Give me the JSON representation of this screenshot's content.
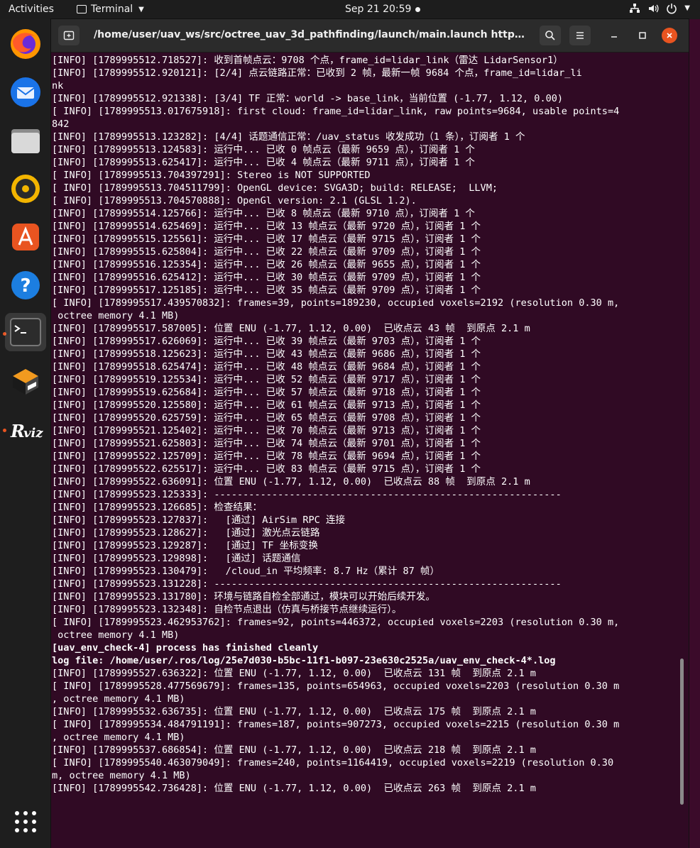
{
  "topbar": {
    "activities": "Activities",
    "app_name": "Terminal",
    "clock": "Sep 21  20:59"
  },
  "dock": {
    "items": [
      "firefox-icon",
      "thunderbird-icon",
      "files-icon",
      "rhythmbox-icon",
      "software-icon",
      "help-icon",
      "terminal-icon",
      "virtualbox-icon",
      "rviz-icon"
    ],
    "apps_grid": "show-applications-icon"
  },
  "window": {
    "title": "/home/user/uav_ws/src/octree_uav_3d_pathfinding/launch/main.launch http://loca..."
  },
  "terminal": {
    "lines": [
      "[INFO] [1789995512.718527]: 收到首帧点云：9708 个点，frame_id=lidar_link（雷达 LidarSensor1）",
      "[INFO] [1789995512.920121]: [2/4] 点云链路正常：已收到 2 帧，最新一帧 9684 个点，frame_id=lidar_li",
      "nk",
      "[INFO] [1789995512.921338]: [3/4] TF 正常：world -> base_link，当前位置 (-1.77, 1.12, 0.00)",
      "[ INFO] [1789995513.017675918]: first cloud: frame_id=lidar_link, raw points=9684, usable points=4",
      "842",
      "[INFO] [1789995513.123282]: [4/4] 话题通信正常：/uav_status 收发成功（1 条），订阅者 1 个",
      "[INFO] [1789995513.124583]: 运行中... 已收 0 帧点云（最新 9659 点），订阅者 1 个",
      "[INFO] [1789995513.625417]: 运行中... 已收 4 帧点云（最新 9711 点），订阅者 1 个",
      "[ INFO] [1789995513.704397291]: Stereo is NOT SUPPORTED",
      "[ INFO] [1789995513.704511799]: OpenGL device: SVGA3D; build: RELEASE;  LLVM;",
      "[ INFO] [1789995513.704570888]: OpenGl version: 2.1 (GLSL 1.2).",
      "[INFO] [1789995514.125766]: 运行中... 已收 8 帧点云（最新 9710 点），订阅者 1 个",
      "[INFO] [1789995514.625469]: 运行中... 已收 13 帧点云（最新 9720 点），订阅者 1 个",
      "[INFO] [1789995515.125561]: 运行中... 已收 17 帧点云（最新 9715 点），订阅者 1 个",
      "[INFO] [1789995515.625804]: 运行中... 已收 22 帧点云（最新 9709 点），订阅者 1 个",
      "[INFO] [1789995516.125354]: 运行中... 已收 26 帧点云（最新 9655 点），订阅者 1 个",
      "[INFO] [1789995516.625412]: 运行中... 已收 30 帧点云（最新 9709 点），订阅者 1 个",
      "[INFO] [1789995517.125185]: 运行中... 已收 35 帧点云（最新 9709 点），订阅者 1 个",
      "[ INFO] [1789995517.439570832]: frames=39, points=189230, occupied voxels=2192 (resolution 0.30 m,",
      " octree memory 4.1 MB)",
      "[INFO] [1789995517.587005]: 位置 ENU (-1.77, 1.12, 0.00)  已收点云 43 帧  到原点 2.1 m",
      "[INFO] [1789995517.626069]: 运行中... 已收 39 帧点云（最新 9703 点），订阅者 1 个",
      "[INFO] [1789995518.125623]: 运行中... 已收 43 帧点云（最新 9686 点），订阅者 1 个",
      "[INFO] [1789995518.625474]: 运行中... 已收 48 帧点云（最新 9684 点），订阅者 1 个",
      "[INFO] [1789995519.125534]: 运行中... 已收 52 帧点云（最新 9717 点），订阅者 1 个",
      "[INFO] [1789995519.625684]: 运行中... 已收 57 帧点云（最新 9718 点），订阅者 1 个",
      "[INFO] [1789995520.125580]: 运行中... 已收 61 帧点云（最新 9713 点），订阅者 1 个",
      "[INFO] [1789995520.625759]: 运行中... 已收 65 帧点云（最新 9708 点），订阅者 1 个",
      "[INFO] [1789995521.125402]: 运行中... 已收 70 帧点云（最新 9713 点），订阅者 1 个",
      "[INFO] [1789995521.625803]: 运行中... 已收 74 帧点云（最新 9701 点），订阅者 1 个",
      "[INFO] [1789995522.125709]: 运行中... 已收 78 帧点云（最新 9694 点），订阅者 1 个",
      "[INFO] [1789995522.625517]: 运行中... 已收 83 帧点云（最新 9715 点），订阅者 1 个",
      "[INFO] [1789995522.636091]: 位置 ENU (-1.77, 1.12, 0.00)  已收点云 88 帧  到原点 2.1 m",
      "[INFO] [1789995523.125333]: ------------------------------------------------------------",
      "[INFO] [1789995523.126685]: 检查结果：",
      "[INFO] [1789995523.127837]:   [通过] AirSim RPC 连接",
      "[INFO] [1789995523.128627]:   [通过] 激光点云链路",
      "[INFO] [1789995523.129287]:   [通过] TF 坐标变换",
      "[INFO] [1789995523.129898]:   [通过] 话题通信",
      "[INFO] [1789995523.130479]:   /cloud_in 平均频率: 8.7 Hz（累计 87 帧）",
      "[INFO] [1789995523.131228]: ------------------------------------------------------------",
      "[INFO] [1789995523.131780]: 环境与链路自检全部通过，模块可以开始后续开发。",
      "[INFO] [1789995523.132348]: 自检节点退出（仿真与桥接节点继续运行）。",
      "[ INFO] [1789995523.462953762]: frames=92, points=446372, occupied voxels=2203 (resolution 0.30 m,",
      " octree memory 4.1 MB)",
      "[uav_env_check-4] process has finished cleanly",
      "log file: /home/user/.ros/log/25e7d030-b5bc-11f1-b097-23e630c2525a/uav_env_check-4*.log",
      "[INFO] [1789995527.636322]: 位置 ENU (-1.77, 1.12, 0.00)  已收点云 131 帧  到原点 2.1 m",
      "[ INFO] [1789995528.477569679]: frames=135, points=654963, occupied voxels=2203 (resolution 0.30 m",
      ", octree memory 4.1 MB)",
      "[INFO] [1789995532.636735]: 位置 ENU (-1.77, 1.12, 0.00)  已收点云 175 帧  到原点 2.1 m",
      "[ INFO] [1789995534.484791191]: frames=187, points=907273, occupied voxels=2215 (resolution 0.30 m",
      ", octree memory 4.1 MB)",
      "[INFO] [1789995537.686854]: 位置 ENU (-1.77, 1.12, 0.00)  已收点云 218 帧  到原点 2.1 m",
      "[ INFO] [1789995540.463079049]: frames=240, points=1164419, occupied voxels=2219 (resolution 0.30",
      "m, octree memory 4.1 MB)",
      "[INFO] [1789995542.736428]: 位置 ENU (-1.77, 1.12, 0.00)  已收点云 263 帧  到原点 2.1 m"
    ],
    "bold_lines": [
      46,
      47
    ]
  }
}
